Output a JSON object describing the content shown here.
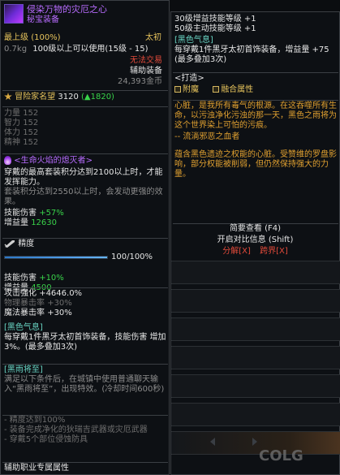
{
  "item": {
    "name": "侵染万物的灾厄之心",
    "type": "秘宝装备",
    "rarity": "最上级",
    "percent": "(100%)",
    "grade": "太初",
    "weight": "0.7kg",
    "level_req": "100级以上可以使用(15级 - 15)",
    "trade": "无法交易",
    "category": "辅助装备",
    "price": "24,393金币"
  },
  "adventurer": {
    "label": "冒险家名望",
    "value": "3120",
    "up": "(▲1820)"
  },
  "stats": [
    {
      "label": "力量",
      "value": "152"
    },
    {
      "label": "智力",
      "value": "152"
    },
    {
      "label": "体力",
      "value": "152"
    },
    {
      "label": "精神",
      "value": "152"
    }
  ],
  "set_effect": {
    "title": "<生命火焰的熄灭者>",
    "desc1": "穿戴的最高套装积分达到2100以上时，才能发挥能力。",
    "desc2": "套装积分达到2550以上时，会发动更强的效果。",
    "skill_label": "技能伤害",
    "skill_value": "+57%",
    "boost_label": "增益量",
    "boost_value": "12630"
  },
  "refine": {
    "label": "精度",
    "progress_text": "100/100%",
    "progress": 1.0,
    "skill_label": "技能伤害",
    "skill_value": "+10%",
    "boost_label": "增益量",
    "boost_value": "4500"
  },
  "attack": [
    {
      "label": "攻击强化",
      "value": "+4646.0%"
    },
    {
      "label": "物理暴击率",
      "value": "+30%"
    },
    {
      "label": "魔法暴击率",
      "value": "+30%"
    }
  ],
  "black_aura_left": {
    "title": "[黑色气息]",
    "desc": "每穿戴1件黑牙太初首饰装备，技能伤害 增加 3%。(最多叠加3次)"
  },
  "black_rain": {
    "title": "[黑雨将至]",
    "desc": "满足以下条件后，在城镇中使用普通聊天输入“黑雨将至”，出现特效。(冷却时间600秒)",
    "conditions": [
      "- 精度达到100%",
      "- 装备完成净化的狄瑞吉武器或灾厄武器",
      "- 穿戴5个部位侵蚀防具"
    ]
  },
  "footer": "辅助职业专属属性",
  "right": {
    "top_lines": [
      "30级增益技能等级 +1",
      "50级主动技能等级 +1"
    ],
    "black_aura": {
      "title": "[黑色气息]",
      "desc": "每穿戴1件黑牙太初首饰装备，增益量 +75 (最多叠加3次)"
    },
    "forge": {
      "title": "<打造>",
      "option1": "附魔",
      "option2": "融合属性"
    },
    "lore1": "心脏，是我所有毒气的根源。在这吞噬所有生命，以污浊净化污浊的那一天，黑色之雨将为这个世界染上可怕的污痕。",
    "lore_author": "-- 流淌邪恶之血者",
    "lore2": "蕴含黑色遗迹之权能的心脏。受赞维的罗盘影响，部分权能被削弱，但仍然保持强大的力量。",
    "menu": {
      "brief": "简要查看 (F4)",
      "compare": "开启对比信息 (Shift)",
      "decompose": "分解[X]",
      "cross": "跨界[X]"
    }
  },
  "watermark": "COLG",
  "colors": {
    "gold": "#e6c35c",
    "red": "#e24a3a",
    "green": "#39d34a",
    "purple": "#b86cff"
  }
}
